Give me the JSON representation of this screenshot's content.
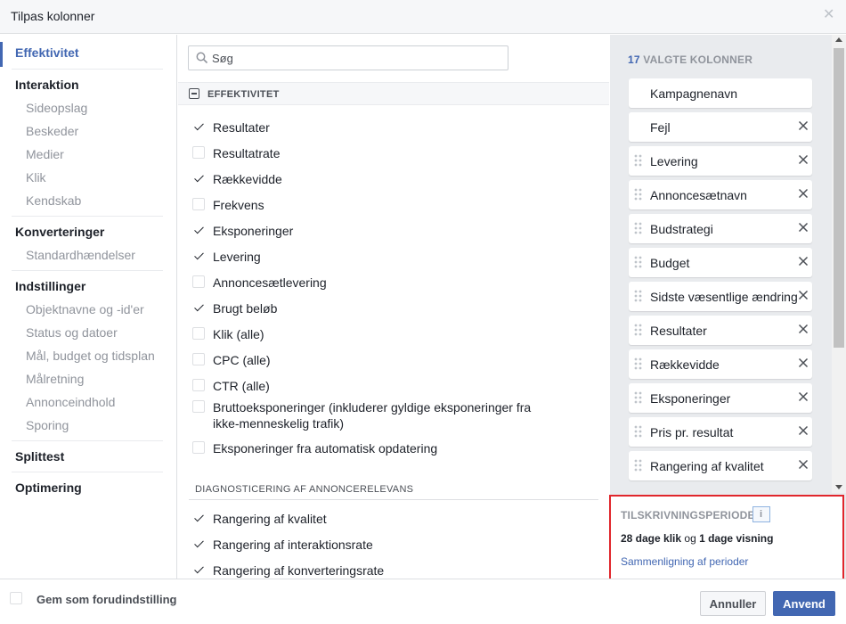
{
  "header": {
    "title": "Tilpas kolonner"
  },
  "nav": {
    "groups": [
      {
        "label": "Effektivitet",
        "active": true,
        "subs": []
      },
      {
        "label": "Interaktion",
        "subs": [
          "Sideopslag",
          "Beskeder",
          "Medier",
          "Klik",
          "Kendskab"
        ]
      },
      {
        "label": "Konverteringer",
        "subs": [
          "Standardhændelser"
        ]
      },
      {
        "label": "Indstillinger",
        "subs": [
          "Objektnavne og -id'er",
          "Status og datoer",
          "Mål, budget og tidsplan",
          "Målretning",
          "Annonceindhold",
          "Sporing"
        ]
      },
      {
        "label": "Splittest",
        "subs": []
      },
      {
        "label": "Optimering",
        "subs": []
      }
    ]
  },
  "search": {
    "placeholder": "Søg",
    "value": ""
  },
  "section": {
    "title": "EFFEKTIVITET"
  },
  "metrics": [
    {
      "label": "Resultater",
      "checked": true
    },
    {
      "label": "Resultatrate",
      "checked": false
    },
    {
      "label": "Rækkevidde",
      "checked": true
    },
    {
      "label": "Frekvens",
      "checked": false
    },
    {
      "label": "Eksponeringer",
      "checked": true
    },
    {
      "label": "Levering",
      "checked": true
    },
    {
      "label": "Annoncesætlevering",
      "checked": false
    },
    {
      "label": "Brugt beløb",
      "checked": true
    },
    {
      "label": "Klik (alle)",
      "checked": false
    },
    {
      "label": "CPC (alle)",
      "checked": false
    },
    {
      "label": "CTR (alle)",
      "checked": false
    },
    {
      "label": "Bruttoeksponeringer (inkluderer gyldige eksponeringer fra ikke-menneskelig trafik)",
      "checked": false
    },
    {
      "label": "Eksponeringer fra automatisk opdatering",
      "checked": false
    }
  ],
  "diagnostics": {
    "title": "DIAGNOSTICERING AF ANNONCERELEVANS",
    "items": [
      {
        "label": "Rangering af kvalitet",
        "checked": true
      },
      {
        "label": "Rangering af interaktionsrate",
        "checked": true
      },
      {
        "label": "Rangering af konverteringsrate",
        "checked": true
      }
    ]
  },
  "selected": {
    "count": "17",
    "count_label": "VALGTE KOLONNER",
    "columns": [
      {
        "label": "Kampagnenavn",
        "removable": false,
        "draggable": false
      },
      {
        "label": "Fejl",
        "removable": true,
        "draggable": false
      },
      {
        "label": "Levering",
        "removable": true,
        "draggable": true
      },
      {
        "label": "Annoncesætnavn",
        "removable": true,
        "draggable": true
      },
      {
        "label": "Budstrategi",
        "removable": true,
        "draggable": true
      },
      {
        "label": "Budget",
        "removable": true,
        "draggable": true
      },
      {
        "label": "Sidste væsentlige ændring",
        "removable": true,
        "draggable": true
      },
      {
        "label": "Resultater",
        "removable": true,
        "draggable": true
      },
      {
        "label": "Rækkevidde",
        "removable": true,
        "draggable": true
      },
      {
        "label": "Eksponeringer",
        "removable": true,
        "draggable": true
      },
      {
        "label": "Pris pr. resultat",
        "removable": true,
        "draggable": true
      },
      {
        "label": "Rangering af kvalitet",
        "removable": true,
        "draggable": true
      }
    ]
  },
  "attribution": {
    "title": "TILSKRIVNINGSPERIODE",
    "click_days": "28 dage klik",
    "joiner": "og",
    "view_days": "1 dage visning",
    "compare_link": "Sammenligning af perioder"
  },
  "footer": {
    "save_default": "Gem som forudindstilling",
    "cancel": "Annuller",
    "apply": "Anvend"
  },
  "colors": {
    "accent": "#4267b2",
    "highlight": "#e0262c"
  }
}
